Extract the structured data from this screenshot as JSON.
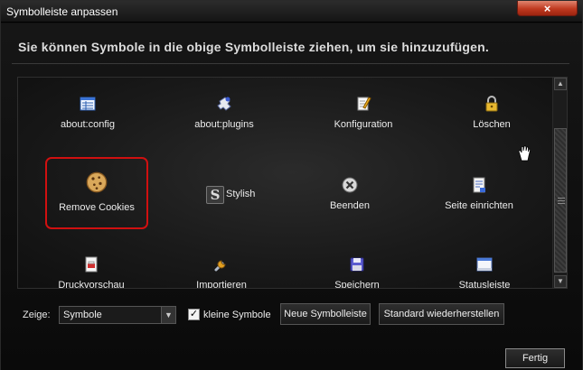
{
  "window": {
    "title": "Symbolleiste anpassen",
    "close_symbol": "×"
  },
  "header": {
    "text": "Sie können Symbole in die obige Symbolleiste ziehen, um sie hinzuzufügen."
  },
  "palette": {
    "items": [
      {
        "label": "about:config",
        "icon": "config-list-icon"
      },
      {
        "label": "about:plugins",
        "icon": "plugin-puzzle-icon"
      },
      {
        "label": "Konfiguration",
        "icon": "notepad-pencil-icon"
      },
      {
        "label": "Löschen",
        "icon": "padlock-icon"
      },
      {
        "label": "Remove Cookies",
        "icon": "cookie-icon"
      },
      {
        "label": "Stylish",
        "icon": "stylish-s-icon",
        "glyph": "S"
      },
      {
        "label": "Beenden",
        "icon": "exit-x-circle-icon"
      },
      {
        "label": "Seite einrichten",
        "icon": "page-setup-icon"
      },
      {
        "label": "Druckvorschau",
        "icon": "print-preview-icon"
      },
      {
        "label": "Importieren",
        "icon": "wrench-icon"
      },
      {
        "label": "Speichern",
        "icon": "floppy-disk-icon"
      },
      {
        "label": "Statusleiste",
        "icon": "status-bar-window-icon"
      }
    ],
    "selected_item": "Remove Cookies"
  },
  "scrollbar": {
    "up_symbol": "▲",
    "down_symbol": "▼"
  },
  "footer": {
    "zeige_label": "Zeige:",
    "zeige_value": "Symbole",
    "dropdown_arrow": "▼",
    "small_icons_label": "kleine Symbole",
    "small_icons_checked": true,
    "check_mark": "✓",
    "new_toolbar_label": "Neue Symbolleiste",
    "restore_default_label": "Standard wiederherstellen",
    "done_label": "Fertig"
  },
  "colors": {
    "selection_border": "#d01010",
    "close_button": "#c0391f",
    "background": "#111111"
  }
}
